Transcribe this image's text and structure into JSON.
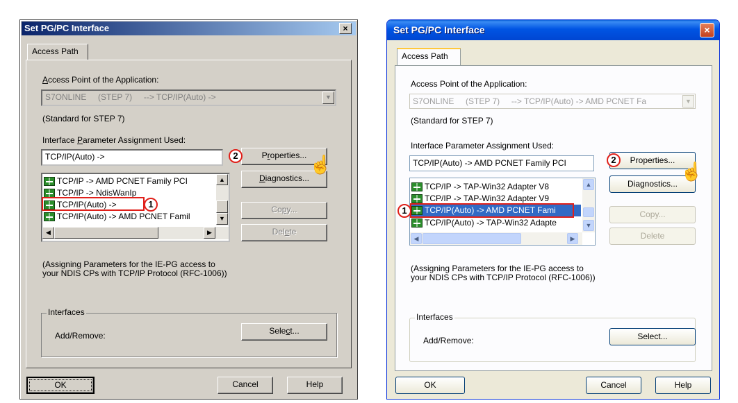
{
  "classic": {
    "title": "Set PG/PC Interface",
    "close_glyph": "×",
    "tab": "Access Path",
    "access_point_label_prefix": "A",
    "access_point_label_rest": "ccess Point of the Application:",
    "access_point_value": "S7ONLINE     (STEP 7)     --> TCP/IP(Auto) ->",
    "access_point_note": "(Standard for STEP 7)",
    "assignment_label_a": "Interface ",
    "assignment_label_u": "P",
    "assignment_label_b": "arameter Assignment Used:",
    "assignment_value": "TCP/IP(Auto) ->",
    "properties_u": "r",
    "properties_a": "P",
    "properties_b": "operties...",
    "diagnostics_u": "D",
    "diagnostics_b": "iagnostics...",
    "copy_a": "Co",
    "copy_u": "p",
    "copy_b": "y...",
    "delete_a": "Del",
    "delete_u": "e",
    "delete_b": "te",
    "list": [
      "TCP/IP -> AMD PCNET Family PCI",
      "TCP/IP -> NdisWanIp",
      "TCP/IP(Auto) ->",
      "TCP/IP(Auto) -> AMD PCNET Famil"
    ],
    "description": "(Assigning Parameters for the IE-PG access to your NDIS CPs with TCP/IP Protocol (RFC-1006))",
    "interfaces_label": "Interfaces",
    "add_remove_label": "Add/Remove:",
    "select_a": "Sele",
    "select_u": "c",
    "select_b": "t...",
    "ok": "OK",
    "cancel": "Cancel",
    "help": "Help",
    "marker1": "1",
    "marker2": "2"
  },
  "xp": {
    "title": "Set PG/PC Interface",
    "close_glyph": "×",
    "tab": "Access Path",
    "access_point_label": "Access Point of the Application:",
    "access_point_value": "S7ONLINE     (STEP 7)     --> TCP/IP(Auto) -> AMD PCNET Fa",
    "access_point_note": "(Standard for STEP 7)",
    "assignment_label": "Interface Parameter Assignment Used:",
    "assignment_value": "TCP/IP(Auto) -> AMD PCNET Family PCI",
    "properties": "Properties...",
    "diagnostics": "Diagnostics...",
    "copy": "Copy...",
    "delete": "Delete",
    "list": [
      "TCP/IP -> TAP-Win32 Adapter V8",
      "TCP/IP -> TAP-Win32 Adapter V9",
      "TCP/IP(Auto) -> AMD PCNET Fami",
      "TCP/IP(Auto) -> TAP-Win32 Adapte"
    ],
    "description": "(Assigning Parameters for the IE-PG access to your NDIS CPs with TCP/IP Protocol (RFC-1006))",
    "interfaces_label": "Interfaces",
    "add_remove_label": "Add/Remove:",
    "select": "Select...",
    "ok": "OK",
    "cancel": "Cancel",
    "help": "Help",
    "marker1": "1",
    "marker2": "2"
  },
  "icons": {
    "pointer": "hand-pointer-icon"
  }
}
